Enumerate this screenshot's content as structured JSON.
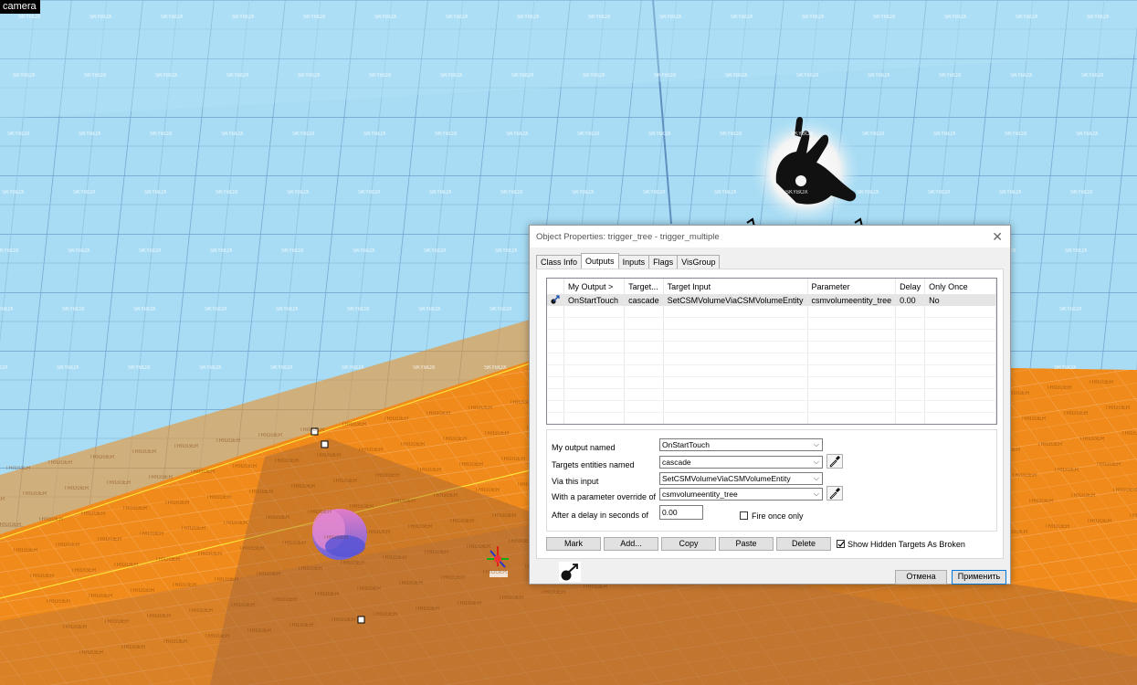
{
  "viewport": {
    "label": "camera",
    "sky_texture_label": "SKYBOX",
    "floor_texture_label": "TRIGGER"
  },
  "dialog": {
    "title": "Object Properties: trigger_tree - trigger_multiple",
    "tabs": [
      "Class Info",
      "Outputs",
      "Inputs",
      "Flags",
      "VisGroup"
    ],
    "active_tab": "Outputs",
    "columns": [
      "My Output  >",
      "Target...",
      "Target Input",
      "Parameter",
      "Delay",
      "Only Once"
    ],
    "rows": [
      {
        "output": "OnStartTouch",
        "target": "cascade",
        "input": "SetCSMVolumeViaCSMVolumeEntity",
        "parameter": "csmvolumeentity_tree",
        "delay": "0.00",
        "once": "No"
      }
    ],
    "form": {
      "output_label": "My output named",
      "output_value": "OnStartTouch",
      "target_label": "Targets entities named",
      "target_value": "cascade",
      "input_label": "Via this input",
      "input_value": "SetCSMVolumeViaCSMVolumeEntity",
      "param_label": "With a parameter override of",
      "param_value": "csmvolumeentity_tree",
      "delay_label": "After a delay in seconds of",
      "delay_value": "0.00",
      "fire_once_label": "Fire once only"
    },
    "buttons": {
      "mark": "Mark",
      "add": "Add...",
      "copy": "Copy",
      "paste": "Paste",
      "delete": "Delete",
      "show_hidden": "Show Hidden Targets As Broken",
      "cancel": "Отмена",
      "apply": "Применить"
    }
  }
}
